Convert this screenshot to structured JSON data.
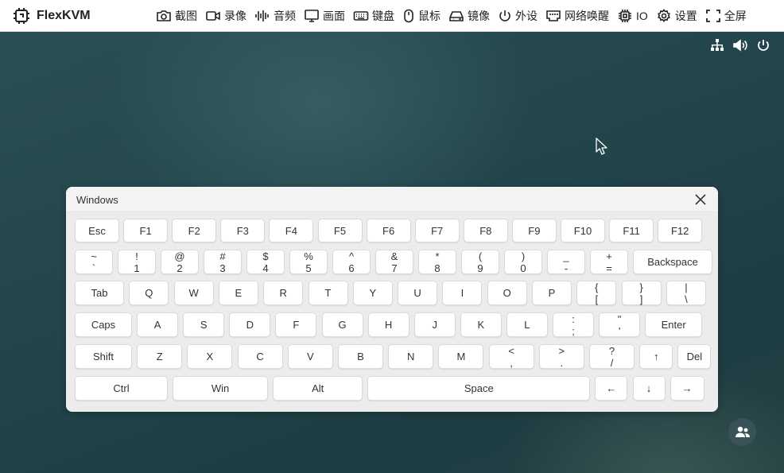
{
  "app": {
    "name": "FlexKVM"
  },
  "menu": [
    {
      "label": "截图",
      "icon": "camera-icon"
    },
    {
      "label": "录像",
      "icon": "video-icon"
    },
    {
      "label": "音频",
      "icon": "audio-wave-icon"
    },
    {
      "label": "画面",
      "icon": "monitor-icon"
    },
    {
      "label": "键盘",
      "icon": "keyboard-icon"
    },
    {
      "label": "鼠标",
      "icon": "mouse-icon"
    },
    {
      "label": "镜像",
      "icon": "drive-icon"
    },
    {
      "label": "外设",
      "icon": "power-icon"
    },
    {
      "label": "网络唤醒",
      "icon": "ethernet-port-icon"
    },
    {
      "label": "IO",
      "icon": "chip-icon"
    },
    {
      "label": "设置",
      "icon": "gear-icon"
    },
    {
      "label": "全屏",
      "icon": "fullscreen-icon"
    }
  ],
  "status_icons": [
    "network-icon",
    "volume-icon",
    "power-icon"
  ],
  "keyboard": {
    "title": "Windows",
    "rows": [
      [
        [
          "Esc"
        ],
        [
          "F1"
        ],
        [
          "F2"
        ],
        [
          "F3"
        ],
        [
          "F4"
        ],
        [
          "F5"
        ],
        [
          "F6"
        ],
        [
          "F7"
        ],
        [
          "F8"
        ],
        [
          "F9"
        ],
        [
          "F10"
        ],
        [
          "F11"
        ],
        [
          "F12"
        ]
      ],
      [
        [
          "~",
          "`"
        ],
        [
          "!",
          "1"
        ],
        [
          "@",
          "2"
        ],
        [
          "#",
          "3"
        ],
        [
          "$",
          "4"
        ],
        [
          "%",
          "5"
        ],
        [
          "^",
          "6"
        ],
        [
          "&",
          "7"
        ],
        [
          "*",
          "8"
        ],
        [
          "(",
          "9"
        ],
        [
          ")",
          "0"
        ],
        [
          "_",
          "-"
        ],
        [
          "+",
          "="
        ],
        [
          "Backspace"
        ]
      ],
      [
        [
          "Tab"
        ],
        [
          "Q"
        ],
        [
          "W"
        ],
        [
          "E"
        ],
        [
          "R"
        ],
        [
          "T"
        ],
        [
          "Y"
        ],
        [
          "U"
        ],
        [
          "I"
        ],
        [
          "O"
        ],
        [
          "P"
        ],
        [
          "{",
          "["
        ],
        [
          "}",
          "]"
        ],
        [
          "|",
          "\\"
        ]
      ],
      [
        [
          "Caps"
        ],
        [
          "A"
        ],
        [
          "S"
        ],
        [
          "D"
        ],
        [
          "F"
        ],
        [
          "G"
        ],
        [
          "H"
        ],
        [
          "J"
        ],
        [
          "K"
        ],
        [
          "L"
        ],
        [
          ":",
          ";"
        ],
        [
          "\"",
          "'"
        ],
        [
          "Enter"
        ]
      ],
      [
        [
          "Shift"
        ],
        [
          "Z"
        ],
        [
          "X"
        ],
        [
          "C"
        ],
        [
          "V"
        ],
        [
          "B"
        ],
        [
          "N"
        ],
        [
          "M"
        ],
        [
          "<",
          ","
        ],
        [
          ">",
          "."
        ],
        [
          "?",
          "/"
        ],
        [
          "↑"
        ],
        [
          "Del"
        ]
      ],
      [
        [
          "Ctrl"
        ],
        [
          "Win"
        ],
        [
          "Alt"
        ],
        [
          "Space"
        ],
        [
          "←"
        ],
        [
          "↓"
        ],
        [
          "→"
        ]
      ]
    ]
  },
  "colors": {
    "accent": "#1f3e44",
    "panel": "#ececec"
  }
}
